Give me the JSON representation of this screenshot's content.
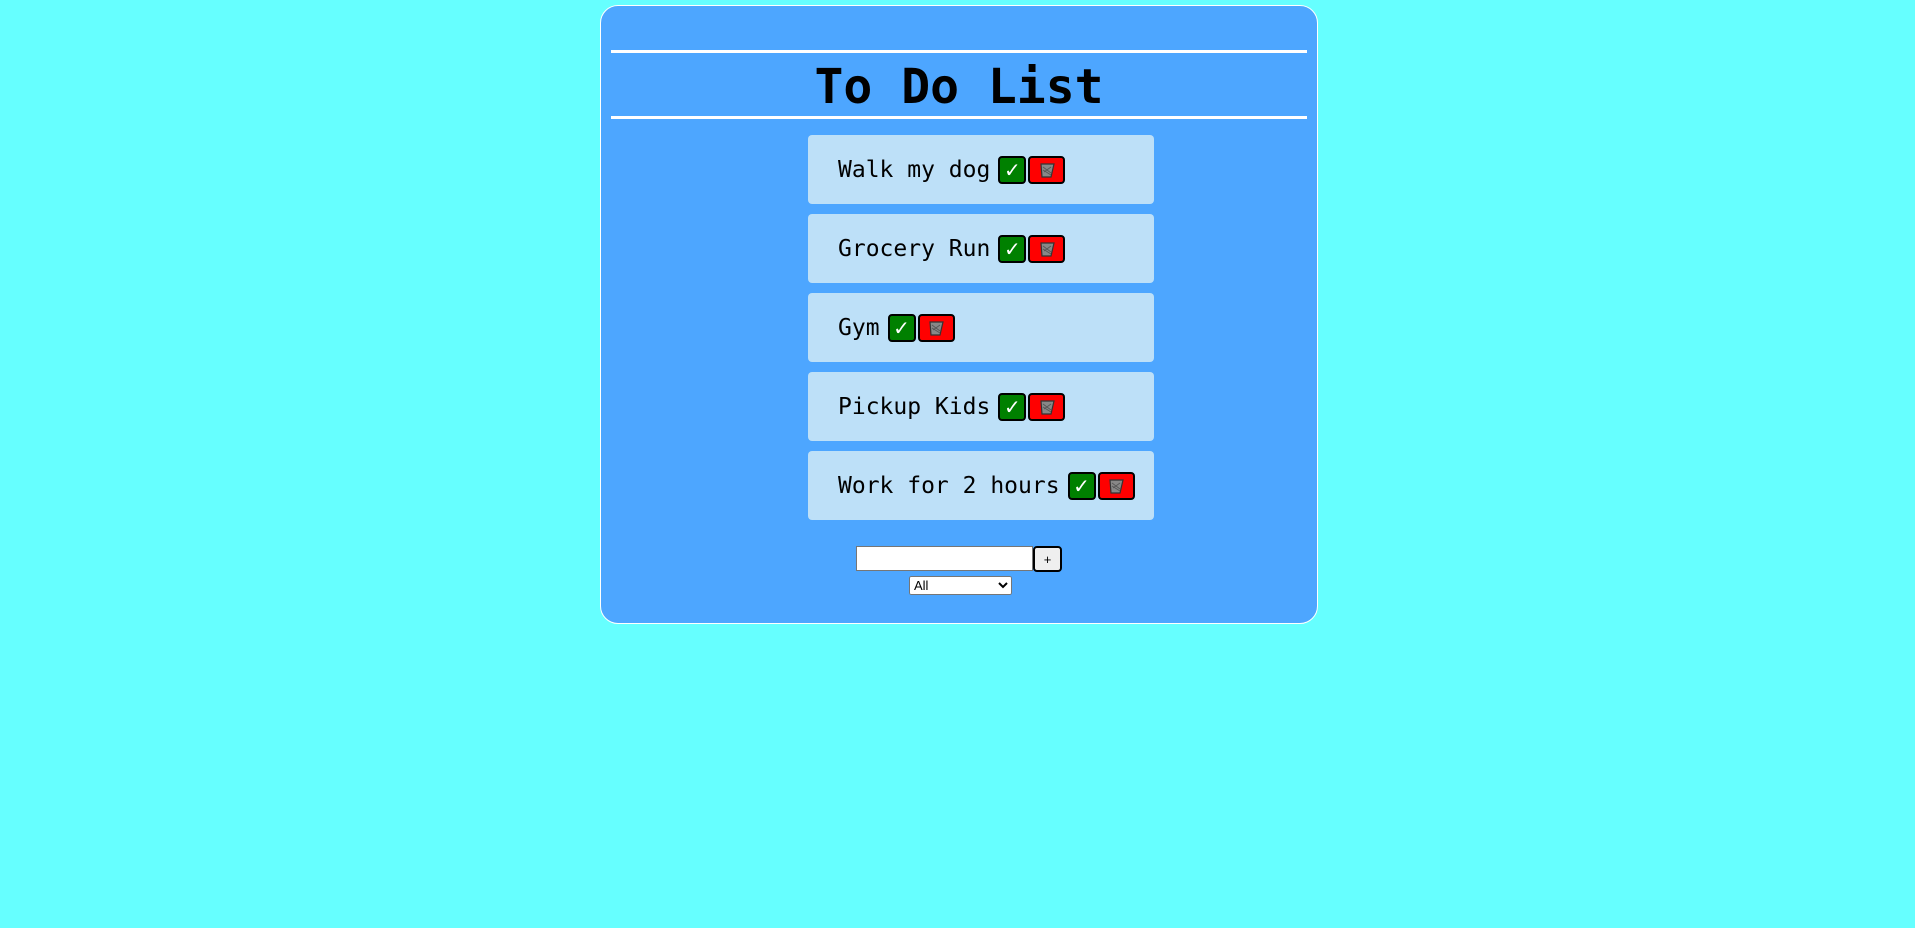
{
  "header": {
    "title": "To Do List"
  },
  "todos": [
    {
      "text": "Walk my dog"
    },
    {
      "text": "Grocery Run"
    },
    {
      "text": "Gym"
    },
    {
      "text": "Pickup Kids"
    },
    {
      "text": "Work for 2 hours"
    }
  ],
  "icons": {
    "complete": "check-icon",
    "delete": "trash-icon",
    "check_glyph": "✓"
  },
  "form": {
    "input_value": "",
    "add_label": "+"
  },
  "filter": {
    "selected": "All"
  },
  "colors": {
    "background": "#66ffff",
    "card": "#4da6ff",
    "item": "#bde0f8",
    "complete": "#008000",
    "delete": "#ff0000"
  }
}
